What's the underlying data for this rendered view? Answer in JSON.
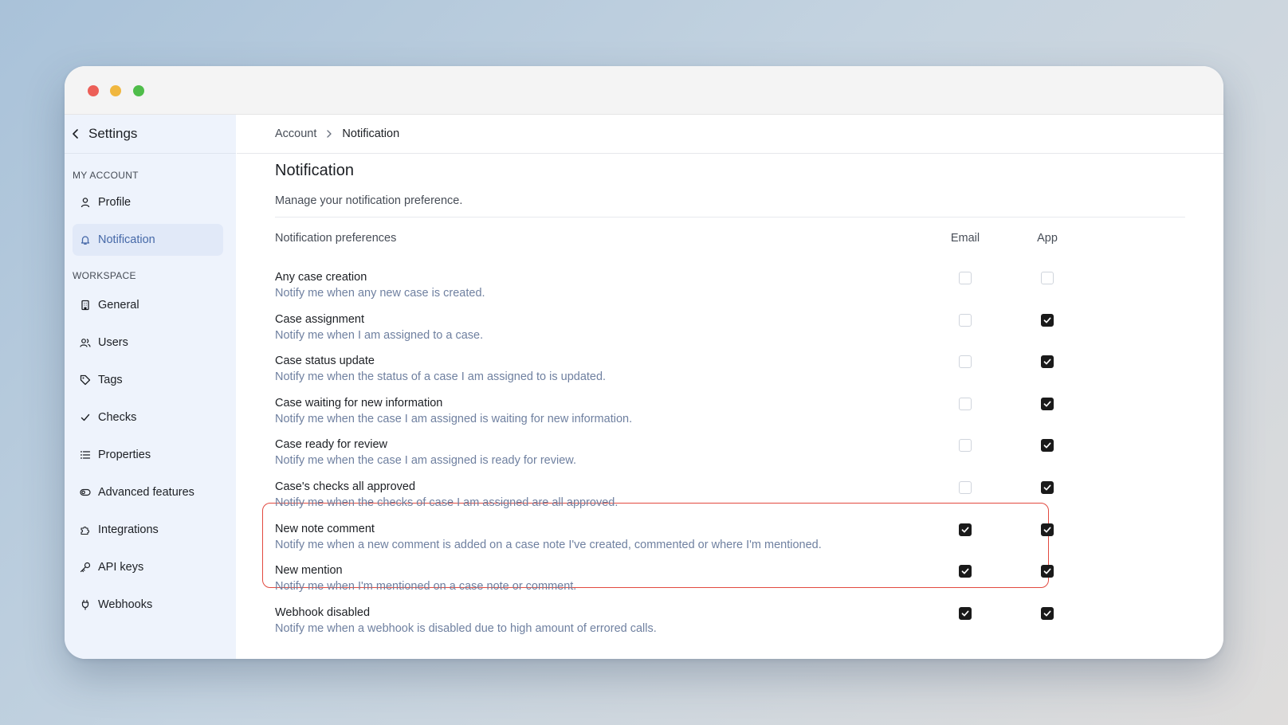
{
  "sidebar": {
    "title": "Settings",
    "back_icon": "chevron-left-icon",
    "sections": {
      "my_account": "MY ACCOUNT",
      "workspace": "WORKSPACE"
    },
    "items": [
      {
        "label": "Profile",
        "icon": "user-icon"
      },
      {
        "label": "Notification",
        "icon": "bell-icon",
        "active": true
      },
      {
        "label": "General",
        "icon": "building-icon"
      },
      {
        "label": "Users",
        "icon": "users-icon"
      },
      {
        "label": "Tags",
        "icon": "tag-icon"
      },
      {
        "label": "Checks",
        "icon": "check-icon"
      },
      {
        "label": "Properties",
        "icon": "list-icon"
      },
      {
        "label": "Advanced features",
        "icon": "toggle-icon"
      },
      {
        "label": "Integrations",
        "icon": "puzzle-icon"
      },
      {
        "label": "API keys",
        "icon": "key-icon"
      },
      {
        "label": "Webhooks",
        "icon": "plug-icon"
      }
    ]
  },
  "breadcrumb": {
    "parent": "Account",
    "current": "Notification"
  },
  "page": {
    "title": "Notification",
    "description": "Manage your notification preference."
  },
  "table": {
    "header": "Notification preferences",
    "email_col": "Email",
    "app_col": "App",
    "rows": [
      {
        "title": "Any case creation",
        "description": "Notify me when any new case is created.",
        "email": false,
        "app": false
      },
      {
        "title": "Case assignment",
        "description": "Notify me when I am assigned to a case.",
        "email": false,
        "app": true
      },
      {
        "title": "Case status update",
        "description": "Notify me when the status of a case I am assigned to is updated.",
        "email": false,
        "app": true
      },
      {
        "title": "Case waiting for new information",
        "description": "Notify me when the case I am assigned is waiting for new information.",
        "email": false,
        "app": true
      },
      {
        "title": "Case ready for review",
        "description": "Notify me when the case I am assigned is ready for review.",
        "email": false,
        "app": true
      },
      {
        "title": "Case's checks all approved",
        "description": "Notify me when the checks of case I am assigned are all approved.",
        "email": false,
        "app": true
      },
      {
        "title": "New note comment",
        "description": "Notify me when a new comment is added on a case note I've created, commented or where I'm mentioned.",
        "email": true,
        "app": true
      },
      {
        "title": "New mention",
        "description": "Notify me when I'm mentioned on a case note or comment.",
        "email": true,
        "app": true
      },
      {
        "title": "Webhook disabled",
        "description": "Notify me when a webhook is disabled due to high amount of errored calls.",
        "email": true,
        "app": true
      }
    ]
  },
  "colors": {
    "accent": "#4669a8",
    "highlight_border": "#e2493f",
    "checkbox_checked": "#1a1a1a"
  }
}
